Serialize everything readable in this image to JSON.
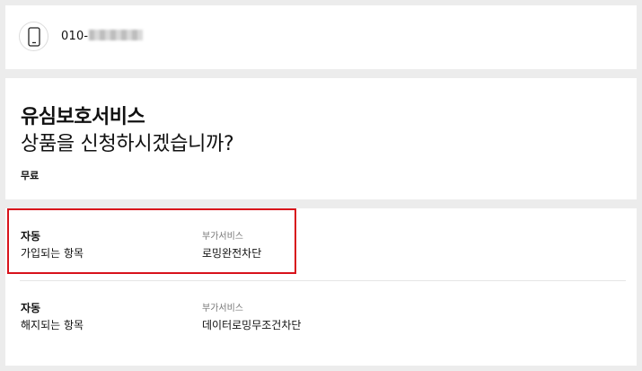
{
  "phone": {
    "icon": "smartphone-icon",
    "number_prefix": "010-"
  },
  "product": {
    "name": "유심보호서비스",
    "question": "상품을 신청하시겠습니까?",
    "price": "무료"
  },
  "items": [
    {
      "type_title": "자동",
      "type_sub": "가입되는 항목",
      "category": "부가서비스",
      "service": "로밍완전차단",
      "highlighted": true
    },
    {
      "type_title": "자동",
      "type_sub": "해지되는 항목",
      "category": "부가서비스",
      "service": "데이터로밍무조건차단",
      "highlighted": false
    }
  ],
  "colors": {
    "highlight": "#d8121b",
    "background": "#ececec"
  }
}
